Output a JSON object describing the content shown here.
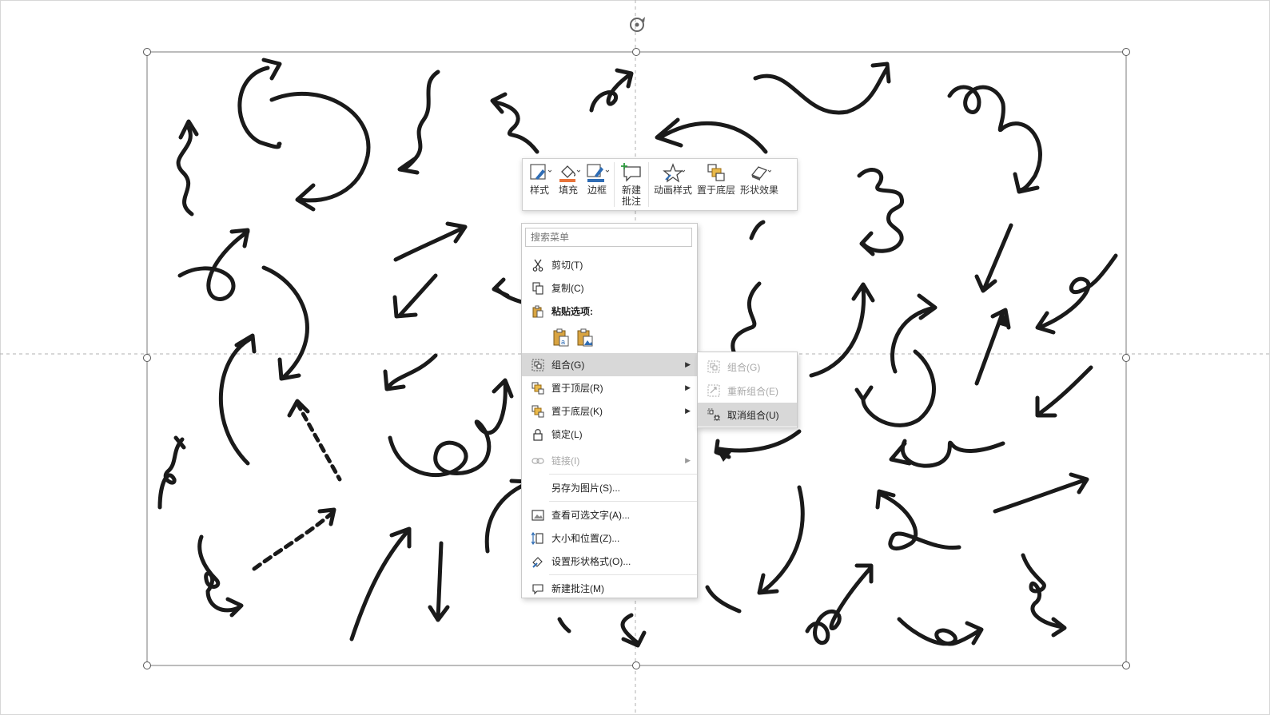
{
  "toolbar": {
    "buttons": [
      {
        "label": "样式",
        "icon": "shape-style-icon"
      },
      {
        "label": "填充",
        "icon": "paint-bucket-icon",
        "accent": "#e8743b"
      },
      {
        "label": "边框",
        "icon": "pen-outline-icon",
        "accent": "#2f6db5"
      },
      {
        "label": "新建\n批注",
        "icon": "new-comment-icon"
      },
      {
        "label": "动画样式",
        "icon": "star-animation-icon"
      },
      {
        "label": "置于底层",
        "icon": "send-to-back-icon"
      },
      {
        "label": "形状效果",
        "icon": "shape-effects-icon"
      }
    ]
  },
  "context_menu": {
    "search_placeholder": "搜索菜单",
    "items": {
      "cut": "剪切(T)",
      "copy": "复制(C)",
      "paste_options": "粘贴选项:",
      "group": "组合(G)",
      "bring_to_front": "置于顶层(R)",
      "send_to_back": "置于底层(K)",
      "lock": "锁定(L)",
      "link": "链接(I)",
      "save_as_picture": "另存为图片(S)...",
      "view_alt_text": "查看可选文字(A)...",
      "size_position": "大小和位置(Z)...",
      "format_shape": "设置形状格式(O)...",
      "new_comment": "新建批注(M)"
    }
  },
  "submenu": {
    "items": {
      "group": "组合(G)",
      "regroup": "重新组合(E)",
      "ungroup": "取消组合(U)"
    }
  },
  "colors": {
    "stroke": "#1a1a1a",
    "highlight": "#d8d8d8",
    "fill_accent": "#e8743b",
    "border_accent": "#2f6db5",
    "paste_accent": "#d9a441"
  }
}
